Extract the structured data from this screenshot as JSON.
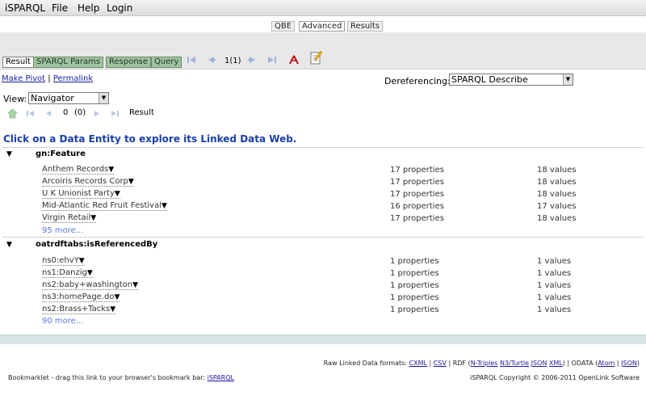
{
  "menu": {
    "app": "iSPARQL",
    "file": "File",
    "help": "Help",
    "login": "Login"
  },
  "modes": {
    "qbe": "QBE",
    "advanced": "Advanced",
    "results": "Results"
  },
  "tabs": {
    "result": "Result",
    "sparql_params": "SPARQL Params",
    "response": "Response",
    "query": "Query"
  },
  "pager": {
    "count": "1(1)"
  },
  "links": {
    "make_pivot": "Make Pivot",
    "separator": "|",
    "permalink": "Permalink"
  },
  "dereferencing": {
    "label": "Dereferencing:",
    "value": "SPARQL Describe"
  },
  "view": {
    "label": "View:",
    "value": "Navigator"
  },
  "mini_pager": {
    "index": "0",
    "total": "(0)",
    "label": "Result"
  },
  "headline": "Click on a Data Entity to explore its Linked Data Web.",
  "groups": [
    {
      "title": "gn:Feature",
      "rows": [
        {
          "name": "Anthem Records",
          "props": "17 properties",
          "vals": "18 values"
        },
        {
          "name": "Arcoiris Records Corp",
          "props": "17 properties",
          "vals": "18 values"
        },
        {
          "name": "U K Unionist Party",
          "props": "17 properties",
          "vals": "18 values"
        },
        {
          "name": "Mid-Atlantic Red Fruit Festival",
          "props": "16 properties",
          "vals": "17 values"
        },
        {
          "name": "Virgin Retail",
          "props": "17 properties",
          "vals": "18 values"
        }
      ],
      "more": "95 more..."
    },
    {
      "title": "oatrdftabs:isReferencedBy",
      "rows": [
        {
          "name": "ns0:ehvY",
          "props": "1 properties",
          "vals": "1 values"
        },
        {
          "name": "ns1:Danzig",
          "props": "1 properties",
          "vals": "1 values"
        },
        {
          "name": "ns2:baby+washington",
          "props": "1 properties",
          "vals": "1 values"
        },
        {
          "name": "ns3:homePage.do",
          "props": "1 properties",
          "vals": "1 values"
        },
        {
          "name": "ns2:Brass+Tacks",
          "props": "1 properties",
          "vals": "1 values"
        }
      ],
      "more": "90 more..."
    }
  ],
  "dropdown_marker": "▼",
  "footer": {
    "raw_label": "Raw Linked Data formats:",
    "cxml": "CXML",
    "sep1": " | ",
    "csv": "CSV",
    "rdf_open": " | RDF (",
    "ntriples": "N-Triples",
    "n3": "N3/Turtle",
    "json1": "JSON",
    "xml": "XML",
    "odata_open": ") | ODATA (",
    "atom": "Atom",
    "json2": "JSON",
    "close": ")",
    "bookmarklet_text": "Bookmarklet - drag this link to your browser's bookmark bar:",
    "bookmarklet_link": "iSPARQL",
    "copyright": "iSPARQL Copyright © 2006-2011 OpenLink Software"
  },
  "colors": {
    "accent_link": "#1a1aa6",
    "headline": "#1a3ea8",
    "tab_green": "#9fc39f",
    "bottom_band": "#d5e5e5"
  }
}
